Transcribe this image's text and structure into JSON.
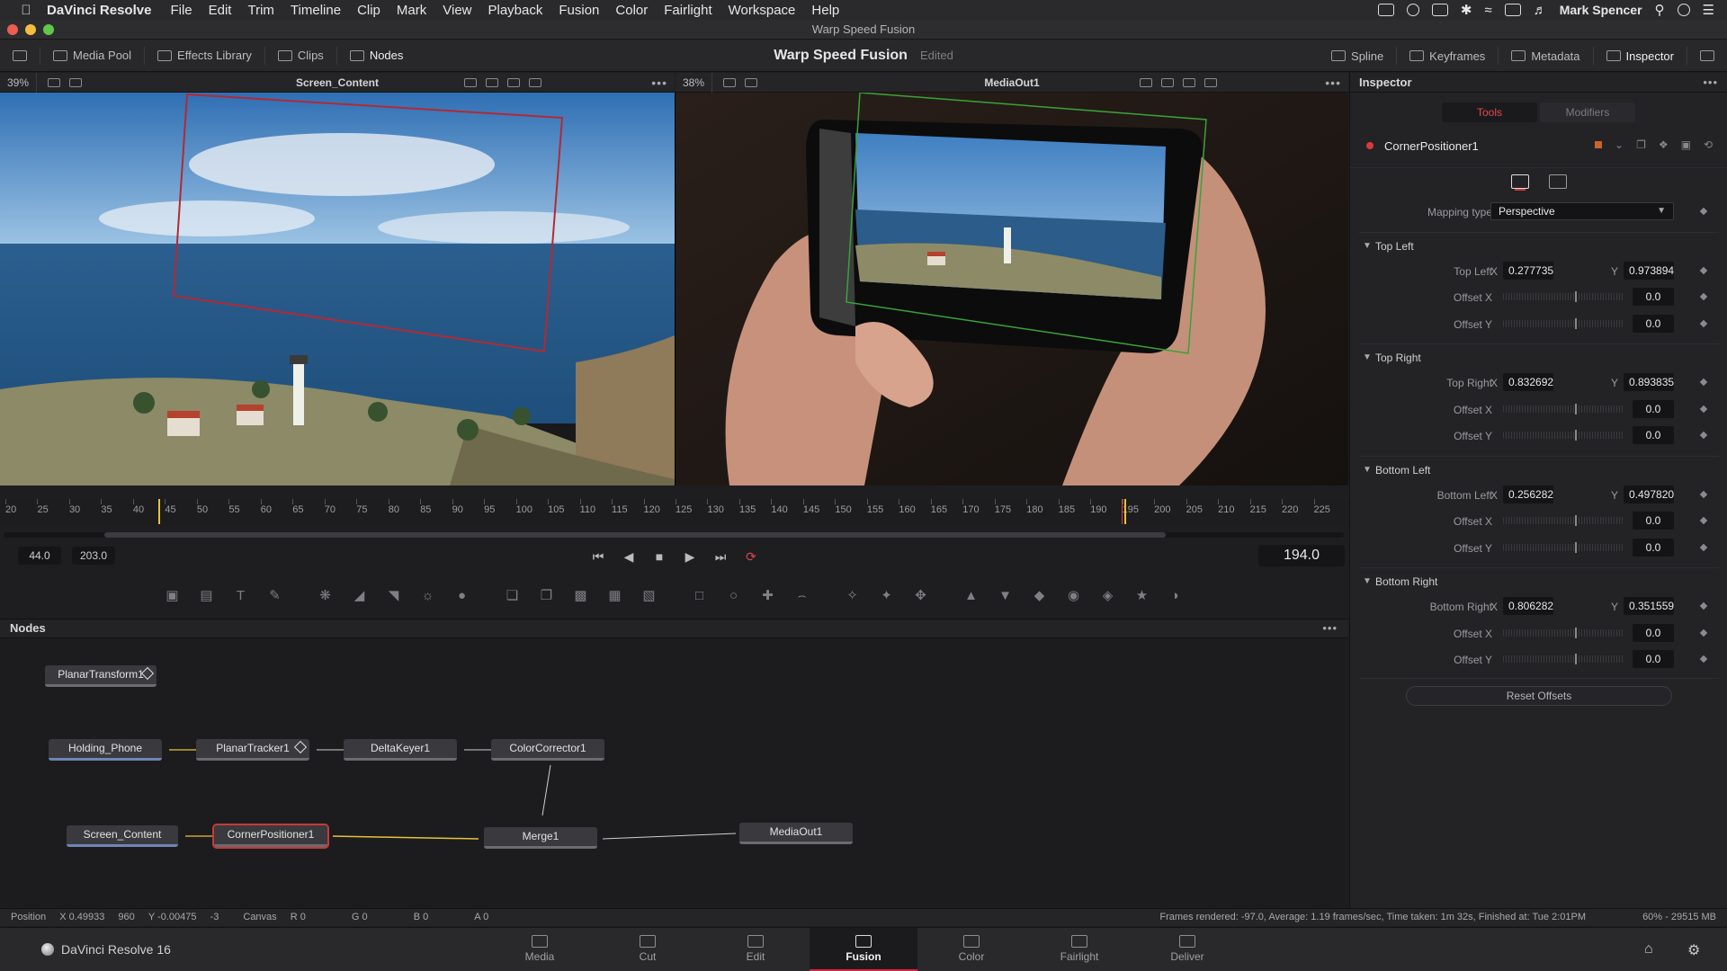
{
  "menubar": {
    "app_name": "DaVinci Resolve",
    "items": [
      "File",
      "Edit",
      "Trim",
      "Timeline",
      "Clip",
      "Mark",
      "View",
      "Playback",
      "Fusion",
      "Color",
      "Fairlight",
      "Workspace",
      "Help"
    ],
    "user": "Mark Spencer"
  },
  "window": {
    "title": "Warp Speed Fusion"
  },
  "toolbar": {
    "media_pool": "Media Pool",
    "effects_library": "Effects Library",
    "clips": "Clips",
    "nodes": "Nodes",
    "project_title": "Warp Speed Fusion",
    "project_state": "Edited",
    "spline": "Spline",
    "keyframes": "Keyframes",
    "metadata": "Metadata",
    "inspector": "Inspector"
  },
  "viewer_left": {
    "zoom": "39%",
    "name": "Screen_Content"
  },
  "viewer_right": {
    "zoom": "38%",
    "name": "MediaOut1"
  },
  "ruler": {
    "labels": [
      "20",
      "25",
      "30",
      "35",
      "40",
      "45",
      "50",
      "55",
      "60",
      "65",
      "70",
      "75",
      "80",
      "85",
      "90",
      "95",
      "100",
      "105",
      "110",
      "115",
      "120",
      "125",
      "130",
      "135",
      "140",
      "145",
      "150",
      "155",
      "160",
      "165",
      "170",
      "175",
      "180",
      "185",
      "190",
      "195",
      "200",
      "205",
      "210",
      "215",
      "220",
      "225"
    ]
  },
  "transport": {
    "start_frame": "44.0",
    "end_frame": "203.0",
    "current_frame": "194.0"
  },
  "nodes_panel": {
    "title": "Nodes",
    "nodes": {
      "planar_transform": "PlanarTransform1",
      "holding_phone": "Holding_Phone",
      "planar_tracker": "PlanarTracker1",
      "delta_keyer": "DeltaKeyer1",
      "color_corrector": "ColorCorrector1",
      "screen_content": "Screen_Content",
      "corner_positioner": "CornerPositioner1",
      "merge": "Merge1",
      "media_out": "MediaOut1"
    }
  },
  "statusbar": {
    "position_label": "Position",
    "pos_x": "X  0.49933",
    "pos_x_px": "960",
    "pos_y": "Y  -0.00475",
    "pos_y_px": "-3",
    "canvas": "Canvas",
    "r": "R  0",
    "g": "G  0",
    "b": "B  0",
    "a": "A  0",
    "render_info": "Frames rendered: -97.0,  Average: 1.19 frames/sec,  Time taken: 1m 32s,  Finished at: Tue 2:01PM",
    "memory": "60% - 29515 MB"
  },
  "pagebar": {
    "brand": "DaVinci Resolve 16",
    "tabs": [
      "Media",
      "Cut",
      "Edit",
      "Fusion",
      "Color",
      "Fairlight",
      "Deliver"
    ],
    "active": "Fusion"
  },
  "inspector": {
    "title": "Inspector",
    "tab_tools": "Tools",
    "tab_modifiers": "Modifiers",
    "tool_name": "CornerPositioner1",
    "mapping_type_label": "Mapping type",
    "mapping_type_value": "Perspective",
    "groups": [
      {
        "title": "Top Left",
        "point_label": "Top Left",
        "x": "0.277735",
        "y": "0.973894",
        "offset_x": "0.0",
        "offset_y": "0.0"
      },
      {
        "title": "Top Right",
        "point_label": "Top Right",
        "x": "0.832692",
        "y": "0.893835",
        "offset_x": "0.0",
        "offset_y": "0.0"
      },
      {
        "title": "Bottom Left",
        "point_label": "Bottom Left",
        "x": "0.256282",
        "y": "0.497820",
        "offset_x": "0.0",
        "offset_y": "0.0"
      },
      {
        "title": "Bottom Right",
        "point_label": "Bottom Right",
        "x": "0.806282",
        "y": "0.351559",
        "offset_x": "0.0",
        "offset_y": "0.0"
      }
    ],
    "offset_x_label": "Offset X",
    "offset_y_label": "Offset Y",
    "x_label": "X",
    "y_label": "Y",
    "reset_offsets": "Reset Offsets"
  },
  "colors": {
    "accent_red": "#d83a3a",
    "active_yellow": "#e8c23a",
    "green_track": "#4caf50"
  }
}
